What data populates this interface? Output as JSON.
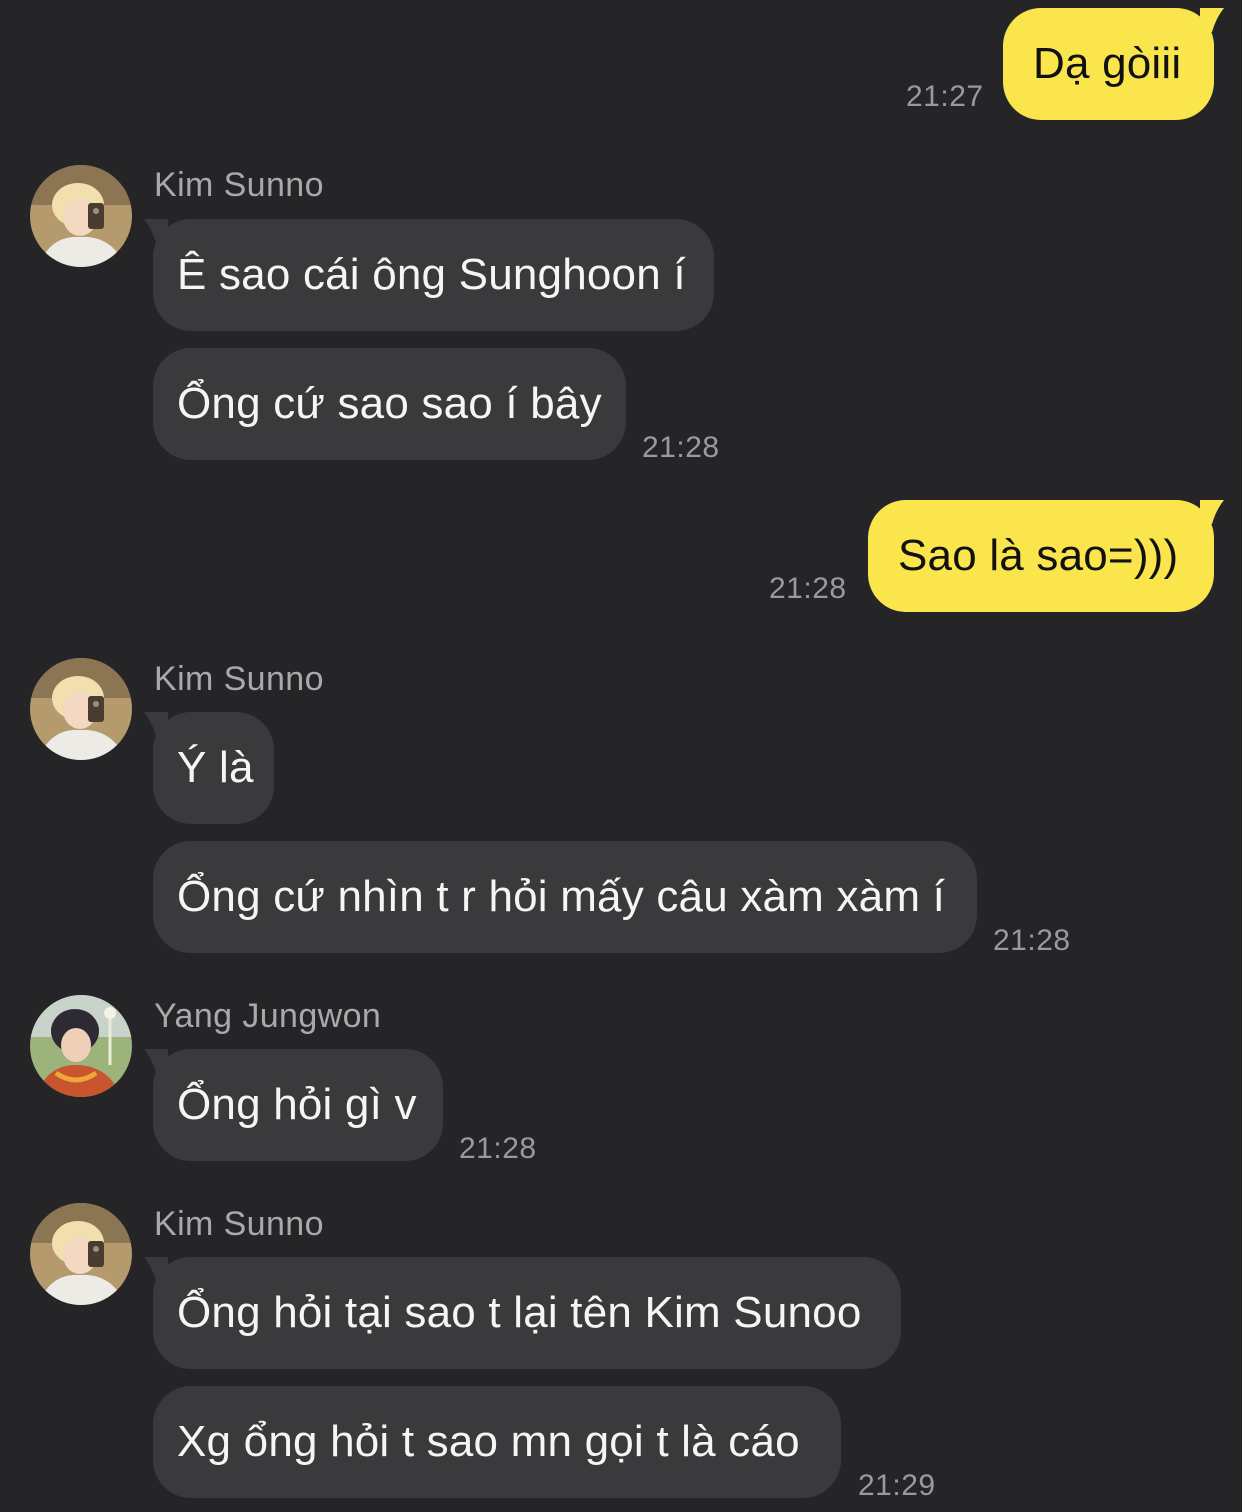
{
  "messages": [
    {
      "id": "m1",
      "direction": "outgoing",
      "text": "Dạ gòiii",
      "time": "21:27"
    },
    {
      "id": "m2",
      "direction": "incoming",
      "sender": "Kim Sunno",
      "text": "Ê sao cái ông Sunghoon í"
    },
    {
      "id": "m3",
      "direction": "incoming",
      "sender": "Kim Sunno",
      "text": "Ổng cứ sao sao í bây",
      "time": "21:28"
    },
    {
      "id": "m4",
      "direction": "outgoing",
      "text": "Sao là sao=)))",
      "time": "21:28"
    },
    {
      "id": "m5",
      "direction": "incoming",
      "sender": "Kim Sunno",
      "text": "Ý là"
    },
    {
      "id": "m6",
      "direction": "incoming",
      "sender": "Kim Sunno",
      "text": "Ổng cứ nhìn t r hỏi mấy câu xàm xàm í",
      "time": "21:28"
    },
    {
      "id": "m7",
      "direction": "incoming",
      "sender": "Yang Jungwon",
      "text": "Ổng hỏi gì v",
      "time": "21:28"
    },
    {
      "id": "m8",
      "direction": "incoming",
      "sender": "Kim Sunno",
      "text": "Ổng hỏi tại sao t lại tên Kim Sunoo"
    },
    {
      "id": "m9",
      "direction": "incoming",
      "sender": "Kim Sunno",
      "text": "Xg ổng hỏi t sao mn gọi t là cáo",
      "time": "21:29"
    }
  ],
  "senders": {
    "group1": "Kim Sunno",
    "group2": "Kim Sunno",
    "group3": "Yang Jungwon",
    "group4": "Kim Sunno"
  },
  "colors": {
    "background": "#252527",
    "incoming_bubble": "#3a3a3c",
    "outgoing_bubble": "#fae64c",
    "timestamp": "#9a9a9c",
    "sender_name": "#a9a9ab"
  },
  "icons": {
    "avatar_kim": "avatar-photo-blonde",
    "avatar_yang": "avatar-photo-dark-hair"
  }
}
